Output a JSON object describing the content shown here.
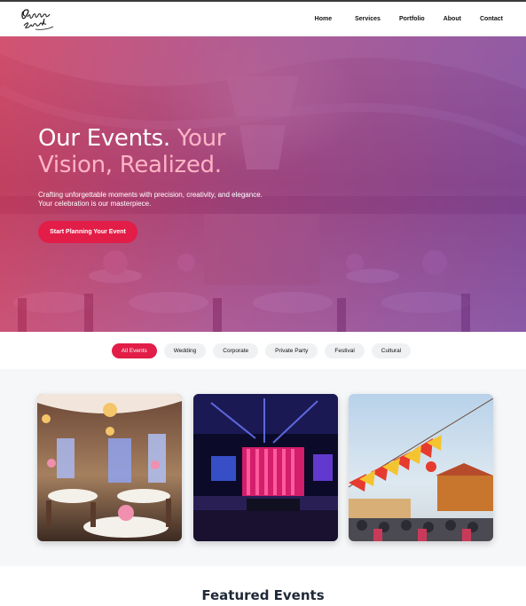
{
  "brand": {
    "logo_text": "Diamora Events"
  },
  "nav": {
    "items": [
      {
        "label": "Home"
      },
      {
        "label": "Services"
      },
      {
        "label": "Portfolio"
      },
      {
        "label": "About"
      },
      {
        "label": "Contact"
      }
    ]
  },
  "hero": {
    "title_part1": "Our Events.",
    "title_accent1": "Your",
    "title_accent2": "Vision, Realized.",
    "subtitle_line1": "Crafting unforgettable moments with precision, creativity, and elegance.",
    "subtitle_line2": "Your celebration is our masterpiece.",
    "cta_label": "Start Planning Your Event"
  },
  "filters": {
    "items": [
      {
        "label": "All Events",
        "active": true
      },
      {
        "label": "Wedding",
        "active": false
      },
      {
        "label": "Corporate",
        "active": false
      },
      {
        "label": "Private Party",
        "active": false
      },
      {
        "label": "Festival",
        "active": false
      },
      {
        "label": "Cultural",
        "active": false
      }
    ]
  },
  "featured": {
    "title": "Featured Events"
  },
  "colors": {
    "accent": "#e11d48",
    "accent_light": "#ffb3c6",
    "hero_overlay_start": "#c82850",
    "hero_overlay_end": "#6e3296"
  }
}
